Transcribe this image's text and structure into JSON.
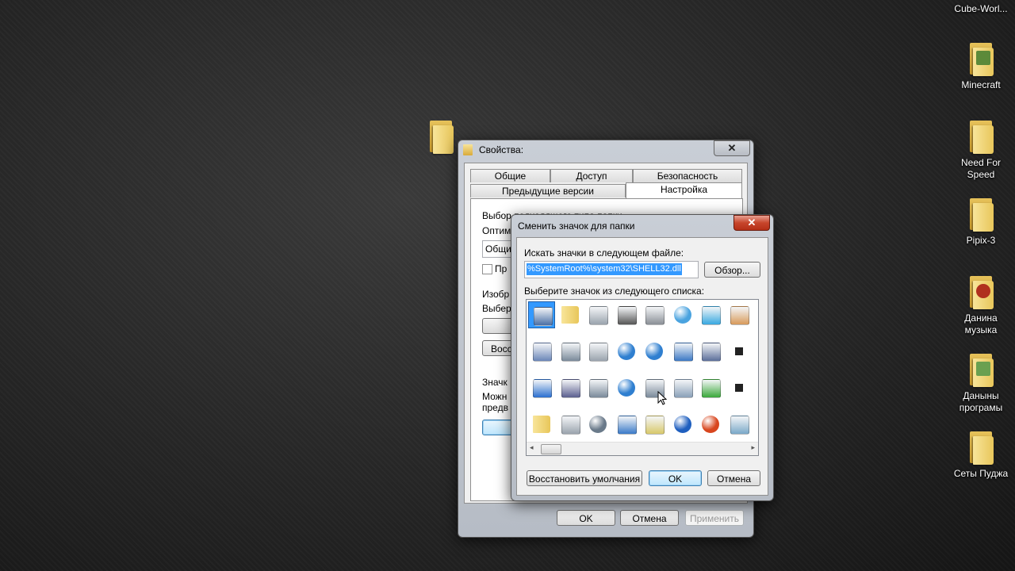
{
  "desktop": {
    "icons": [
      {
        "label": "Cube-Worl...",
        "color": "#d9b44a"
      },
      {
        "label": "Minecraft",
        "color": "#5c8a3a"
      },
      {
        "label": "Need For Speed",
        "color": "#e8c65a"
      },
      {
        "label": "Pipix-3",
        "color": "#e8c65a"
      },
      {
        "label": "Данина музыка",
        "color": "#b0301e"
      },
      {
        "label": "Даныны програмы",
        "color": "#6aa050"
      },
      {
        "label": "Сеты Пуджа",
        "color": "#e8c65a"
      }
    ]
  },
  "properties": {
    "title": "Свойства:",
    "close": "✕",
    "tabs_row1": [
      "Общие",
      "Доступ",
      "Безопасность"
    ],
    "tabs_row2": [
      "Предыдущие версии",
      "Настройка"
    ],
    "active_tab": "Настройка",
    "partial": {
      "l1": "Выбор подходящего типа папки",
      "l2": "Оптим",
      "l3": "Общи",
      "l4": "Пр",
      "l5": "Изобр",
      "l6": "Выбер",
      "l7": "Восс",
      "l8": "Значк",
      "l9": "Можн",
      "l10": "предв"
    },
    "ok": "OK",
    "cancel": "Отмена",
    "apply": "Применить"
  },
  "change_icon": {
    "title": "Сменить значок для папки",
    "close": "✕",
    "file_label": "Искать значки в следующем файле:",
    "file_value": "%SystemRoot%\\system32\\SHELL32.dll",
    "browse": "Обзор...",
    "list_label": "Выберите значок из следующего списка:",
    "icons": [
      "file-doc-icon",
      "folder-icon",
      "drive-icon",
      "chip-icon",
      "printer-icon",
      "clock-icon",
      "monitor-icon",
      "hand-share-icon",
      "text-doc-icon",
      "network-drive-icon",
      "drive-icon",
      "globe-icon",
      "globe-network-icon",
      "control-panel-icon",
      "device-icon",
      "shortcut-arrow-icon",
      "window-icon",
      "floppy-icon",
      "network-drive-disconnected-icon",
      "globe-web-icon",
      "network-tree-icon",
      "search-magnifier-icon",
      "green-arrow-icon",
      "camera-icon",
      "folder-icon",
      "drive-icon",
      "cd-drive-icon",
      "computer-icon",
      "calculator-grid-icon",
      "help-icon",
      "power-icon",
      "recycle-bin-icon"
    ],
    "restore": "Восстановить умолчания",
    "ok": "OK",
    "cancel": "Отмена"
  }
}
